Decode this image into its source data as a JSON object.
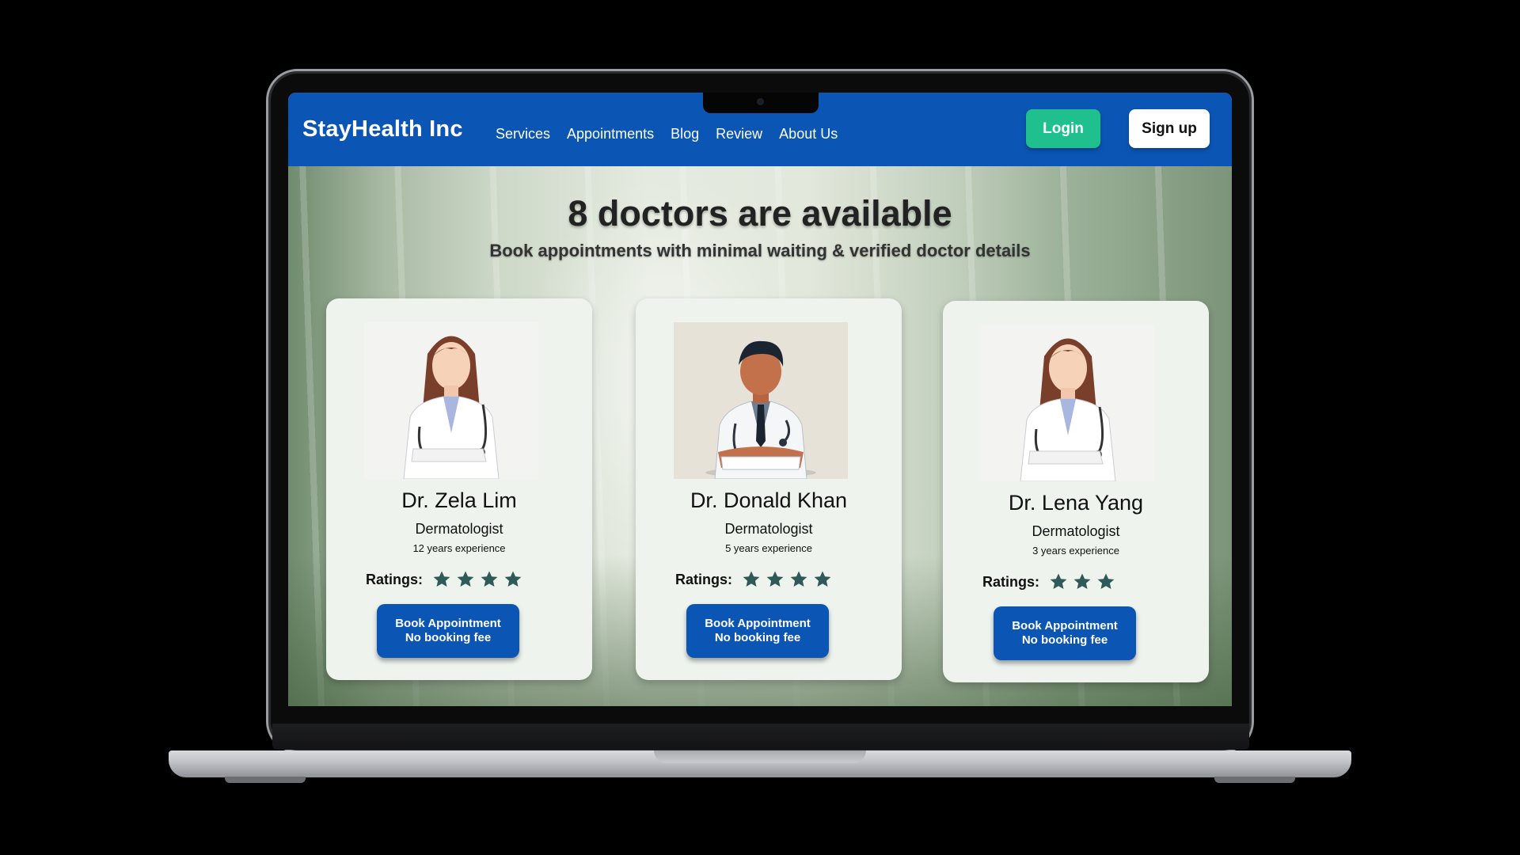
{
  "navbar": {
    "brand": "StayHealth Inc",
    "links": [
      "Services",
      "Appointments",
      "Blog",
      "Review",
      "About Us"
    ],
    "login_label": "Login",
    "signup_label": "Sign up"
  },
  "hero": {
    "title": "8 doctors are available",
    "subtitle": "Book appointments with minimal waiting & verified doctor details"
  },
  "doctors": [
    {
      "name": "Dr. Zela Lim",
      "specialty": "Dermatologist",
      "experience": "12 years experience",
      "ratings_label": "Ratings:",
      "rating": 4,
      "book_line1": "Book Appointment",
      "book_line2": "No booking fee"
    },
    {
      "name": "Dr. Donald Khan",
      "specialty": "Dermatologist",
      "experience": "5 years experience",
      "ratings_label": "Ratings:",
      "rating": 4,
      "book_line1": "Book Appointment",
      "book_line2": "No booking fee"
    },
    {
      "name": "Dr. Lena Yang",
      "specialty": "Dermatologist",
      "experience": "3 years experience",
      "ratings_label": "Ratings:",
      "rating": 3,
      "book_line1": "Book Appointment",
      "book_line2": "No booking fee"
    }
  ],
  "colors": {
    "nav_blue": "#0b55b4",
    "login_green": "#1fc08e",
    "star_color": "#2f5a57"
  }
}
